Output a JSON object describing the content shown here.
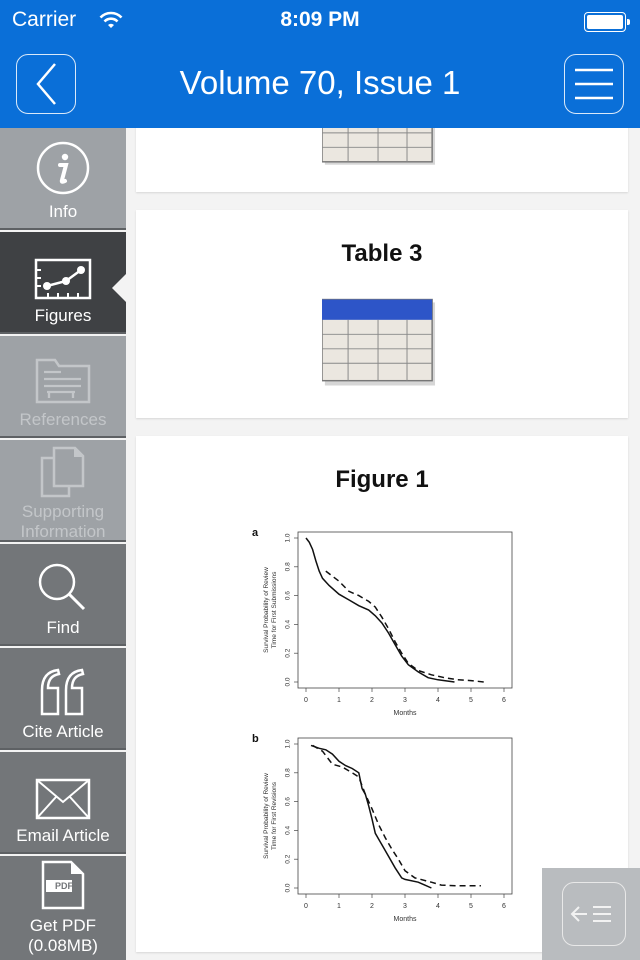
{
  "status_bar": {
    "carrier": "Carrier",
    "time": "8:09 PM"
  },
  "header": {
    "title": "Volume 70, Issue 1",
    "back_icon": "chevron-left-icon",
    "menu_icon": "hamburger-menu-icon"
  },
  "sidebar": {
    "items": [
      {
        "label": "Info",
        "icon": "info-icon",
        "state": "normal"
      },
      {
        "label": "Figures",
        "icon": "figures-chart-icon",
        "state": "selected"
      },
      {
        "label": "References",
        "icon": "references-folder-icon",
        "state": "disabled"
      },
      {
        "label": "Supporting\nInformation",
        "label_line1": "Supporting",
        "label_line2": "Information",
        "icon": "documents-icon",
        "state": "disabled"
      },
      {
        "label": "Find",
        "icon": "search-icon",
        "state": "normal"
      },
      {
        "label": "Cite Article",
        "icon": "quote-icon",
        "state": "normal"
      },
      {
        "label": "Email Article",
        "icon": "envelope-icon",
        "state": "normal"
      },
      {
        "label_line1": "Get PDF",
        "label_line2": "(0.08MB)",
        "icon": "pdf-file-icon",
        "state": "normal"
      }
    ],
    "pdf_badge": "PDF"
  },
  "content": {
    "cards": [
      {
        "title": "",
        "type": "table-thumbnail"
      },
      {
        "title": "Table 3",
        "type": "table-thumbnail"
      },
      {
        "title": "Figure 1",
        "type": "figure"
      }
    ]
  },
  "collapse_button": {
    "icon": "collapse-sidebar-icon"
  },
  "chart_data": [
    {
      "type": "line",
      "panel_label": "a",
      "xlabel": "Months",
      "ylabel_line1": "Survival Probability of Review",
      "ylabel_line2": "Time for First Submissions",
      "xlim": [
        0,
        6
      ],
      "ylim": [
        0,
        1
      ],
      "x_ticks": [
        "0",
        "1",
        "2",
        "3",
        "4",
        "5",
        "6"
      ],
      "y_ticks": [
        "0.0",
        "0.2",
        "0.4",
        "0.6",
        "0.8",
        "1.0"
      ],
      "series": [
        {
          "name": "solid",
          "style": "solid",
          "x": [
            0,
            0.1,
            0.2,
            0.3,
            0.4,
            0.5,
            0.7,
            1.0,
            1.3,
            1.6,
            1.9,
            2.1,
            2.3,
            2.5,
            2.7,
            2.9,
            3.1,
            3.4,
            3.7,
            4.0,
            4.5
          ],
          "y": [
            1.0,
            0.97,
            0.92,
            0.84,
            0.77,
            0.72,
            0.67,
            0.61,
            0.57,
            0.53,
            0.5,
            0.46,
            0.41,
            0.34,
            0.26,
            0.18,
            0.12,
            0.07,
            0.03,
            0.015,
            0.0
          ]
        },
        {
          "name": "dashed",
          "style": "dashed",
          "x": [
            0.6,
            1.0,
            1.3,
            1.6,
            1.9,
            2.1,
            2.3,
            2.5,
            2.7,
            2.9,
            3.1,
            3.4,
            3.8,
            4.2,
            4.6,
            5.0,
            5.4
          ],
          "y": [
            0.77,
            0.7,
            0.63,
            0.6,
            0.56,
            0.52,
            0.45,
            0.37,
            0.28,
            0.2,
            0.13,
            0.08,
            0.05,
            0.03,
            0.015,
            0.01,
            0.0
          ]
        }
      ]
    },
    {
      "type": "line",
      "panel_label": "b",
      "xlabel": "Months",
      "ylabel_line1": "Survival Probability of Review",
      "ylabel_line2": "Time for First Revisions",
      "xlim": [
        0,
        6
      ],
      "ylim": [
        0,
        1
      ],
      "x_ticks": [
        "0",
        "1",
        "2",
        "3",
        "4",
        "5",
        "6"
      ],
      "y_ticks": [
        "0.0",
        "0.2",
        "0.4",
        "0.6",
        "0.8",
        "1.0"
      ],
      "series": [
        {
          "name": "solid",
          "style": "solid",
          "x": [
            0.15,
            0.4,
            0.6,
            0.8,
            1.0,
            1.2,
            1.4,
            1.6,
            1.7,
            1.8,
            1.9,
            2.0,
            2.1,
            2.3,
            2.5,
            2.7,
            2.9,
            3.0,
            3.4,
            3.6,
            3.8
          ],
          "y": [
            0.99,
            0.97,
            0.96,
            0.93,
            0.88,
            0.85,
            0.83,
            0.8,
            0.69,
            0.65,
            0.57,
            0.48,
            0.38,
            0.3,
            0.22,
            0.14,
            0.07,
            0.06,
            0.04,
            0.02,
            0.0
          ]
        },
        {
          "name": "dashed",
          "style": "dashed",
          "x": [
            0.2,
            0.5,
            0.8,
            1.1,
            1.4,
            1.6,
            1.8,
            2.0,
            2.2,
            2.4,
            2.6,
            2.8,
            3.0,
            3.3,
            3.8,
            4.1,
            4.6,
            5.3
          ],
          "y": [
            0.99,
            0.95,
            0.86,
            0.84,
            0.8,
            0.77,
            0.65,
            0.55,
            0.44,
            0.35,
            0.27,
            0.2,
            0.12,
            0.07,
            0.04,
            0.02,
            0.015,
            0.015
          ]
        }
      ]
    }
  ]
}
